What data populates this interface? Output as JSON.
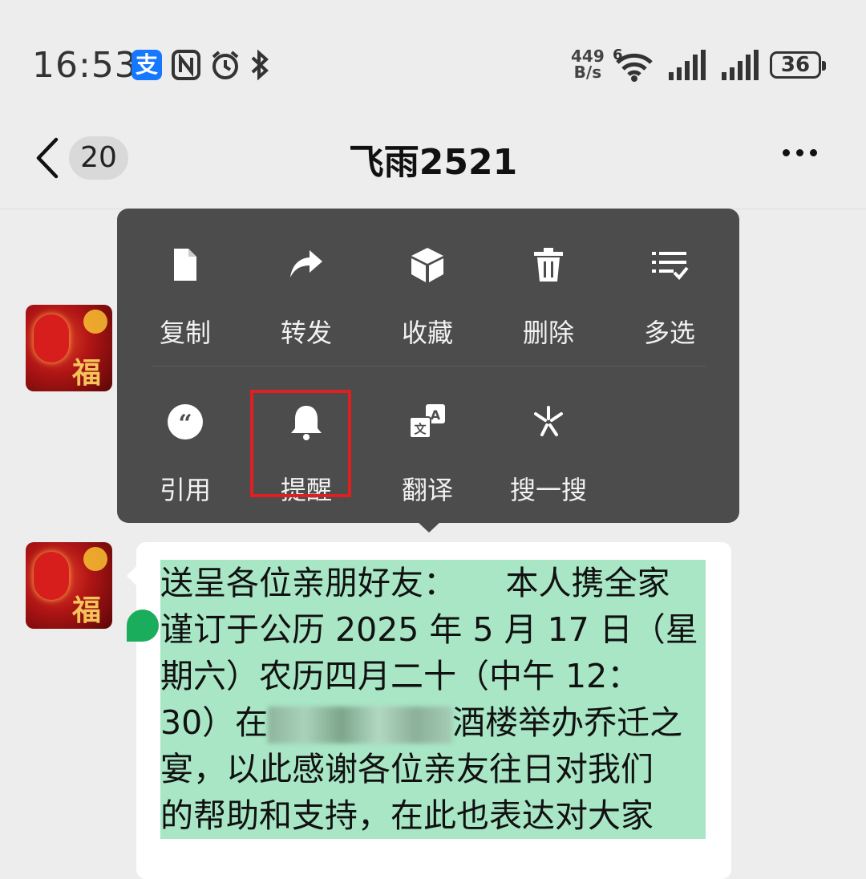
{
  "status_bar": {
    "time": "16:53",
    "alipay_glyph": "支",
    "nfc_icon": "nfc-icon",
    "alarm_icon": "alarm-icon",
    "bluetooth_icon": "bluetooth-icon",
    "net_speed_value": "449",
    "net_speed_unit": "B/s",
    "wifi_label": "6",
    "battery": "36"
  },
  "header": {
    "unread_count": "20",
    "title": "飞雨2521"
  },
  "menu": {
    "row1": [
      {
        "label": "复制",
        "icon": "document-icon"
      },
      {
        "label": "转发",
        "icon": "forward-icon"
      },
      {
        "label": "收藏",
        "icon": "cube-icon"
      },
      {
        "label": "删除",
        "icon": "trash-icon"
      },
      {
        "label": "多选",
        "icon": "multi-select-icon"
      }
    ],
    "row2": [
      {
        "label": "引用",
        "icon": "quote-icon"
      },
      {
        "label": "提醒",
        "icon": "bell-icon"
      },
      {
        "label": "翻译",
        "icon": "translate-icon"
      },
      {
        "label": "搜一搜",
        "icon": "search-spark-icon"
      }
    ]
  },
  "message": {
    "lines": [
      "送呈各位亲朋好友：　　本人携全家",
      "谨订于公历 2025 年 5 月 17 日（星",
      "期六）农历四月二十（中午 12：",
      "30）在",
      "宴，以此感谢各位亲友往日对我们",
      "的帮助和支持，在此也表达对大家"
    ],
    "line4_after_blur": "酒楼举办乔迁之",
    "fu_char": "福"
  },
  "colors": {
    "menu_bg": "#4c4c4c",
    "highlight": "#e02020",
    "selection": "#a8e6c6",
    "handle": "#1aad5c"
  }
}
